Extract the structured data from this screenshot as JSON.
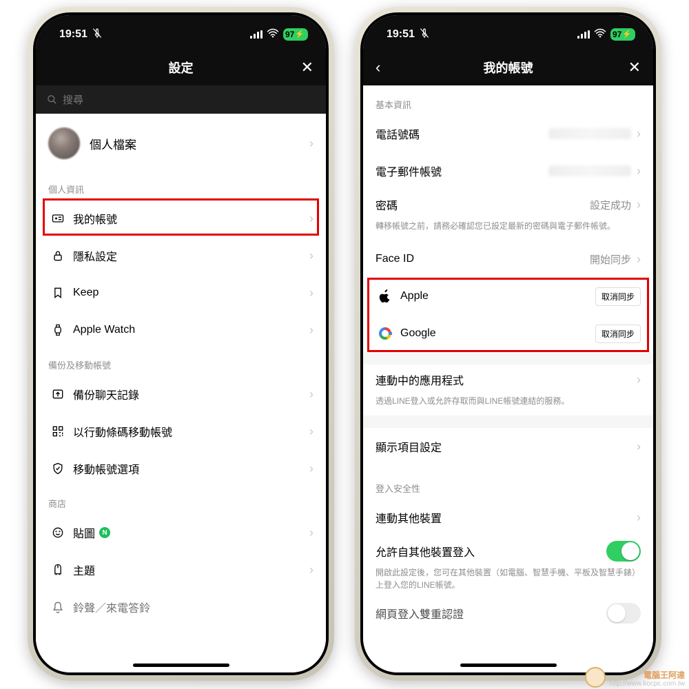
{
  "status": {
    "time": "19:51",
    "battery": "97"
  },
  "settings": {
    "title": "設定",
    "search_placeholder": "搜尋",
    "profile": "個人檔案",
    "sections": {
      "personal_info": "個人資訊",
      "backup": "備份及移動帳號",
      "store": "商店"
    },
    "items": {
      "my_account": "我的帳號",
      "privacy": "隱私設定",
      "keep": "Keep",
      "apple_watch": "Apple Watch",
      "backup_chat": "備份聊天記錄",
      "move_qr": "以行動條碼移動帳號",
      "move_options": "移動帳號選項",
      "stickers": "貼圖",
      "themes": "主題",
      "ringtone_cut": "鈴聲／來電答鈴"
    }
  },
  "account": {
    "title": "我的帳號",
    "sections": {
      "basic": "基本資訊",
      "security": "登入安全性"
    },
    "items": {
      "phone": "電話號碼",
      "email": "電子郵件帳號",
      "password": "密碼",
      "password_status": "設定成功",
      "password_note": "轉移帳號之前，請務必確認您已設定最新的密碼與電子郵件帳號。",
      "faceid": "Face ID",
      "faceid_status": "開始同步",
      "apple": "Apple",
      "google": "Google",
      "unlink": "取消同步",
      "connected_apps": "連動中的應用程式",
      "connected_apps_note": "透過LINE登入或允許存取而與LINE帳號連結的服務。",
      "display_settings": "顯示項目設定",
      "other_devices": "連動其他裝置",
      "allow_other_login": "允許自其他裝置登入",
      "allow_other_login_note": "開啟此設定後，您可在其他裝置（如電腦、智慧手機、平板及智慧手錶）上登入您的LINE帳號。",
      "web_2fa": "網頁登入雙重認證"
    }
  },
  "watermark": {
    "name": "電腦王阿達",
    "url": "http://www.kocpc.com.tw"
  }
}
